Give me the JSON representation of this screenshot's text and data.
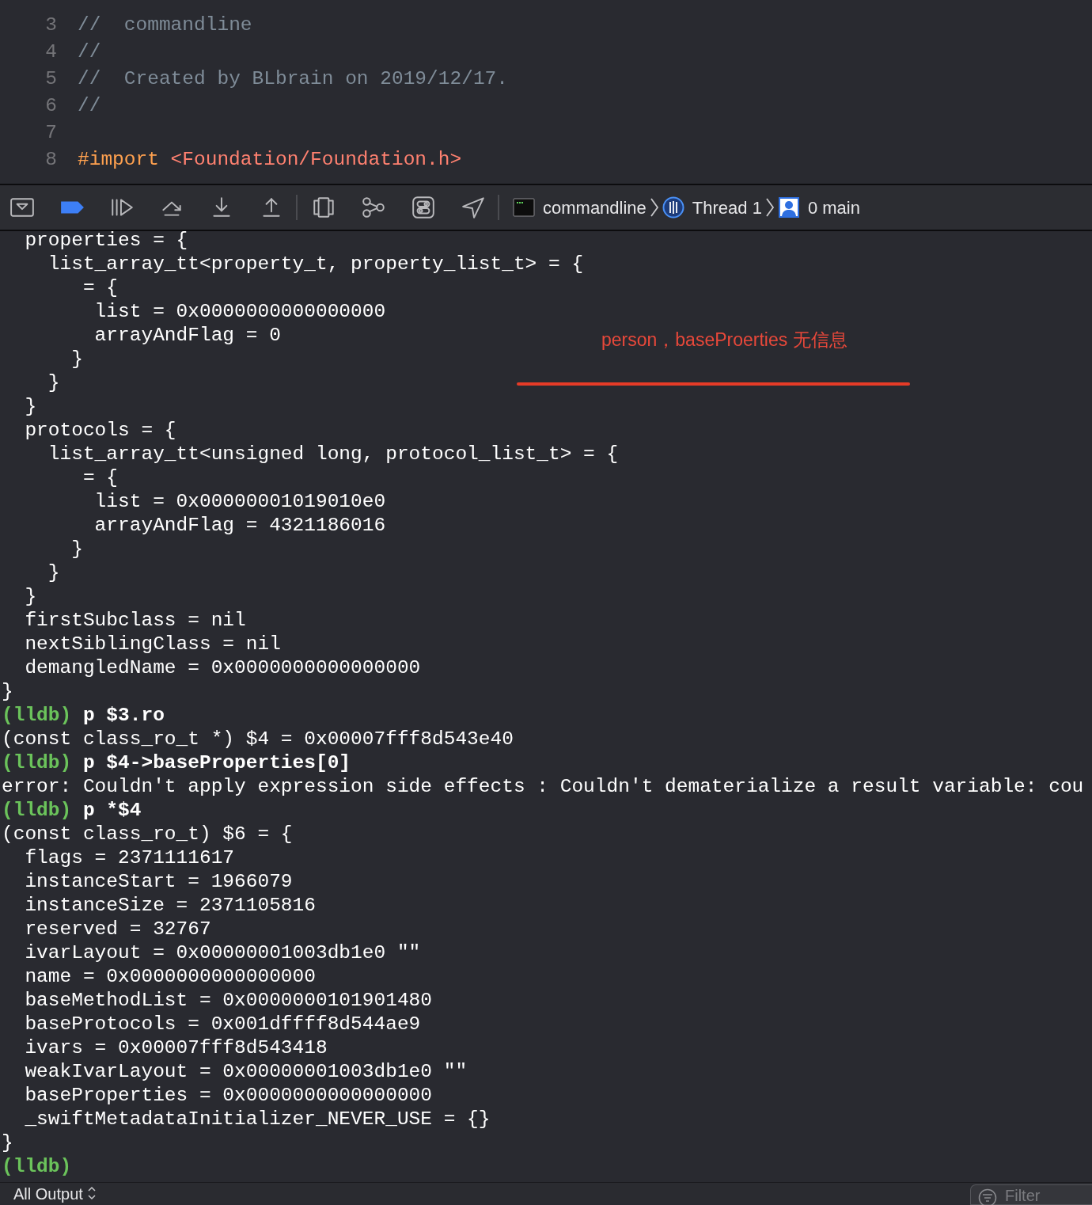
{
  "editor": {
    "lines": [
      {
        "number": "3",
        "segments": [
          {
            "kind": "comment",
            "text": "//  commandline"
          }
        ]
      },
      {
        "number": "4",
        "segments": [
          {
            "kind": "comment",
            "text": "//"
          }
        ]
      },
      {
        "number": "5",
        "segments": [
          {
            "kind": "comment",
            "text": "//  Created by BLbrain on 2019/12/17."
          }
        ]
      },
      {
        "number": "6",
        "segments": [
          {
            "kind": "comment",
            "text": "//"
          }
        ]
      },
      {
        "number": "7"
      },
      {
        "number": "8",
        "segments": [
          {
            "kind": "keyword",
            "text": "#import"
          },
          {
            "kind": "string",
            "text": "<Foundation/Foundation.h>"
          }
        ]
      }
    ]
  },
  "debug_bar": {
    "buttons": [
      {
        "kind": "console-toggle",
        "on": false
      },
      {
        "kind": "breakpoints",
        "on": true
      },
      {
        "kind": "continue",
        "on": false
      },
      {
        "kind": "step-over",
        "on": false
      },
      {
        "kind": "step-into",
        "on": false
      },
      {
        "kind": "step-out",
        "on": false
      },
      {
        "kind": "separator"
      },
      {
        "kind": "view-debugger",
        "on": false
      },
      {
        "kind": "memory-graph",
        "on": false
      },
      {
        "kind": "environment",
        "on": false
      },
      {
        "kind": "location",
        "on": false
      },
      {
        "kind": "separator"
      }
    ],
    "path": [
      {
        "kind": "target",
        "label": "commandline"
      },
      {
        "kind": "thread",
        "label": "Thread 1"
      },
      {
        "kind": "frame",
        "label": "0 main"
      }
    ]
  },
  "console": {
    "lines": [
      {
        "kind": "output",
        "text": "  properties = {"
      },
      {
        "kind": "output",
        "text": "    list_array_tt<property_t, property_list_t> = {"
      },
      {
        "kind": "output",
        "text": "       = {"
      },
      {
        "kind": "output",
        "text": "        list = 0x0000000000000000"
      },
      {
        "kind": "output",
        "text": "        arrayAndFlag = 0"
      },
      {
        "kind": "output",
        "text": "      }"
      },
      {
        "kind": "output",
        "text": "    }"
      },
      {
        "kind": "output",
        "text": "  }"
      },
      {
        "kind": "output",
        "text": "  protocols = {"
      },
      {
        "kind": "output",
        "text": "    list_array_tt<unsigned long, protocol_list_t> = {"
      },
      {
        "kind": "output",
        "text": "       = {"
      },
      {
        "kind": "output",
        "text": "        list = 0x00000001019010e0"
      },
      {
        "kind": "output",
        "text": "        arrayAndFlag = 4321186016"
      },
      {
        "kind": "output",
        "text": "      }"
      },
      {
        "kind": "output",
        "text": "    }"
      },
      {
        "kind": "output",
        "text": "  }"
      },
      {
        "kind": "output",
        "text": "  firstSubclass = nil"
      },
      {
        "kind": "output",
        "text": "  nextSiblingClass = nil"
      },
      {
        "kind": "output",
        "text": "  demangledName = 0x0000000000000000"
      },
      {
        "kind": "output",
        "text": "}"
      },
      {
        "kind": "command",
        "prompt": "(lldb)",
        "text": "p $3.ro"
      },
      {
        "kind": "output",
        "text": "(const class_ro_t *) $4 = 0x00007fff8d543e40"
      },
      {
        "kind": "command",
        "prompt": "(lldb)",
        "text": "p $4->baseProperties[0]"
      },
      {
        "kind": "output",
        "text": "error: Couldn't apply expression side effects : Couldn't dematerialize a result variable: cou"
      },
      {
        "kind": "command",
        "prompt": "(lldb)",
        "text": "p *$4"
      },
      {
        "kind": "output",
        "text": "(const class_ro_t) $6 = {"
      },
      {
        "kind": "output",
        "text": "  flags = 2371111617"
      },
      {
        "kind": "output",
        "text": "  instanceStart = 1966079"
      },
      {
        "kind": "output",
        "text": "  instanceSize = 2371105816"
      },
      {
        "kind": "output",
        "text": "  reserved = 32767"
      },
      {
        "kind": "output",
        "text": "  ivarLayout = 0x00000001003db1e0 \"\""
      },
      {
        "kind": "output",
        "text": "  name = 0x0000000000000000"
      },
      {
        "kind": "output",
        "text": "  baseMethodList = 0x0000000101901480"
      },
      {
        "kind": "output",
        "text": "  baseProtocols = 0x001dffff8d544ae9"
      },
      {
        "kind": "output",
        "text": "  ivars = 0x00007fff8d543418"
      },
      {
        "kind": "output",
        "text": "  weakIvarLayout = 0x00000001003db1e0 \"\""
      },
      {
        "kind": "output",
        "text": "  baseProperties = 0x0000000000000000"
      },
      {
        "kind": "output",
        "text": "  _swiftMetadataInitializer_NEVER_USE = {}"
      },
      {
        "kind": "output",
        "text": "}"
      },
      {
        "kind": "command",
        "prompt": "(lldb)"
      }
    ]
  },
  "annotation": {
    "text": "person，baseProerties 无信息"
  },
  "bottom_bar": {
    "scope": "All Output",
    "filter": {
      "placeholder": "Filter"
    }
  }
}
